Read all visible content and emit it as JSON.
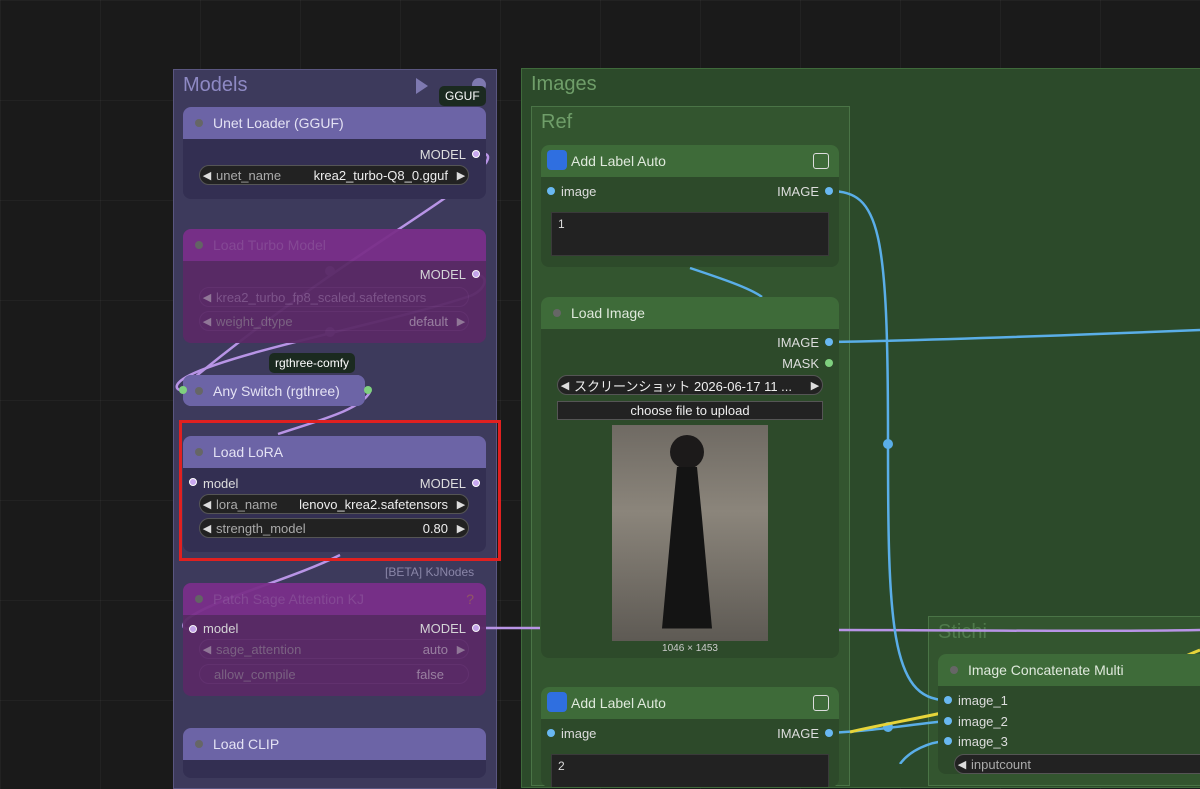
{
  "groups": {
    "models": "Models",
    "images": "Images",
    "ref": "Ref",
    "stichi": "Stichi"
  },
  "tags": {
    "gguf": "GGUF",
    "rgthree": "rgthree-comfy",
    "kjnodes": "[BETA] KJNodes"
  },
  "nodes": {
    "unet_loader": {
      "title": "Unet Loader (GGUF)",
      "output": "MODEL",
      "widget_label": "unet_name",
      "widget_value": "krea2_turbo-Q8_0.gguf"
    },
    "load_turbo": {
      "title": "Load Turbo Model",
      "output": "MODEL",
      "widget1_value": "krea2_turbo_fp8_scaled.safetensors",
      "widget2_label": "weight_dtype",
      "widget2_value": "default"
    },
    "any_switch": {
      "title": "Any Switch (rgthree)"
    },
    "load_lora": {
      "title": "Load LoRA",
      "input": "model",
      "output": "MODEL",
      "w1_label": "lora_name",
      "w1_value": "lenovo_krea2.safetensors",
      "w2_label": "strength_model",
      "w2_value": "0.80"
    },
    "patch_sage": {
      "title": "Patch Sage Attention KJ",
      "input": "model",
      "output": "MODEL",
      "w1_label": "sage_attention",
      "w1_value": "auto",
      "w2_label": "allow_compile",
      "w2_value": "false",
      "help": "?"
    },
    "load_clip": {
      "title": "Load CLIP"
    },
    "add_label_1": {
      "title": "Add Label Auto",
      "input": "image",
      "output": "IMAGE",
      "text": "1"
    },
    "load_image": {
      "title": "Load Image",
      "out1": "IMAGE",
      "out2": "MASK",
      "file": "スクリーンショット 2026-06-17 11 ...",
      "upload": "choose file to upload",
      "dims": "1046 × 1453"
    },
    "add_label_2": {
      "title": "Add Label Auto",
      "input": "image",
      "output": "IMAGE",
      "text": "2"
    },
    "concat": {
      "title": "Image Concatenate Multi",
      "in1": "image_1",
      "in2": "image_2",
      "in3": "image_3",
      "w1_label": "inputcount"
    }
  },
  "colors": {
    "accent_purple": "#6c64a6",
    "group_green": "#2c4a2a",
    "wire_blue": "#5aaee8",
    "wire_purple": "#b894e6",
    "highlight": "#e02020"
  }
}
